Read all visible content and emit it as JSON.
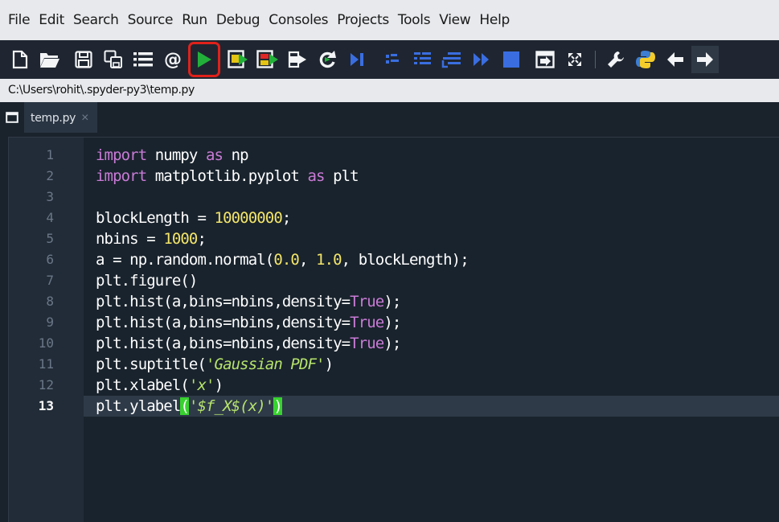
{
  "menu": [
    "File",
    "Edit",
    "Search",
    "Source",
    "Run",
    "Debug",
    "Consoles",
    "Projects",
    "Tools",
    "View",
    "Help"
  ],
  "toolbar": {
    "buttons": [
      "new-file-icon",
      "open-folder-icon",
      "save-icon",
      "save-all-icon",
      "list-icon",
      "at-icon",
      "run-icon",
      "run-cell-icon",
      "run-cell-advance-icon",
      "run-selection-icon",
      "rerun-icon",
      "debug-step-icon",
      "debug-cell-icon",
      "step-into-icon",
      "step-return-icon",
      "continue-icon",
      "stop-icon",
      "maximize-pane-icon",
      "fullscreen-icon",
      "wrench-icon",
      "python-icon",
      "back-arrow-icon",
      "forward-arrow-icon"
    ],
    "highlighted": "run-icon",
    "at_symbol": "@"
  },
  "path": "C:\\Users\\rohit\\.spyder-py3\\temp.py",
  "tab": {
    "label": "temp.py",
    "close": "×"
  },
  "editor": {
    "current_line": 13,
    "line_numbers": [
      "1",
      "2",
      "3",
      "4",
      "5",
      "6",
      "7",
      "8",
      "9",
      "10",
      "11",
      "12",
      "13"
    ],
    "lines": [
      [
        [
          "kw",
          "import"
        ],
        [
          "id",
          " numpy "
        ],
        [
          "kw",
          "as"
        ],
        [
          "id",
          " np"
        ]
      ],
      [
        [
          "kw",
          "import"
        ],
        [
          "id",
          " matplotlib.pyplot "
        ],
        [
          "kw",
          "as"
        ],
        [
          "id",
          " plt"
        ]
      ],
      [],
      [
        [
          "id",
          "blockLength = "
        ],
        [
          "num",
          "10000000"
        ],
        [
          "id",
          ";"
        ]
      ],
      [
        [
          "id",
          "nbins = "
        ],
        [
          "num",
          "1000"
        ],
        [
          "id",
          ";"
        ]
      ],
      [
        [
          "id",
          "a = np.random.normal("
        ],
        [
          "num",
          "0.0"
        ],
        [
          "id",
          ", "
        ],
        [
          "num",
          "1.0"
        ],
        [
          "id",
          ", blockLength);"
        ]
      ],
      [
        [
          "id",
          "plt.figure()"
        ]
      ],
      [
        [
          "id",
          "plt.hist(a,bins=nbins,density="
        ],
        [
          "kw",
          "True"
        ],
        [
          "id",
          ");"
        ]
      ],
      [
        [
          "id",
          "plt.hist(a,bins=nbins,density="
        ],
        [
          "kw",
          "True"
        ],
        [
          "id",
          ");"
        ]
      ],
      [
        [
          "id",
          "plt.hist(a,bins=nbins,density="
        ],
        [
          "kw",
          "True"
        ],
        [
          "id",
          ");"
        ]
      ],
      [
        [
          "id",
          "plt.suptitle("
        ],
        [
          "str",
          "'Gaussian PDF'"
        ],
        [
          "id",
          ")"
        ]
      ],
      [
        [
          "id",
          "plt.xlabel("
        ],
        [
          "str",
          "'x'"
        ],
        [
          "id",
          ")"
        ]
      ],
      [
        [
          "id",
          "plt.ylabel"
        ],
        [
          "paren",
          "("
        ],
        [
          "str",
          "'$f_X$(x)'"
        ],
        [
          "paren",
          ")"
        ]
      ]
    ]
  },
  "colors": {
    "keyword": "#c97bd6",
    "number": "#f3e56a",
    "string": "#b6e36c",
    "highlight_border": "#e0211b",
    "paren_match": "#38d22f"
  }
}
